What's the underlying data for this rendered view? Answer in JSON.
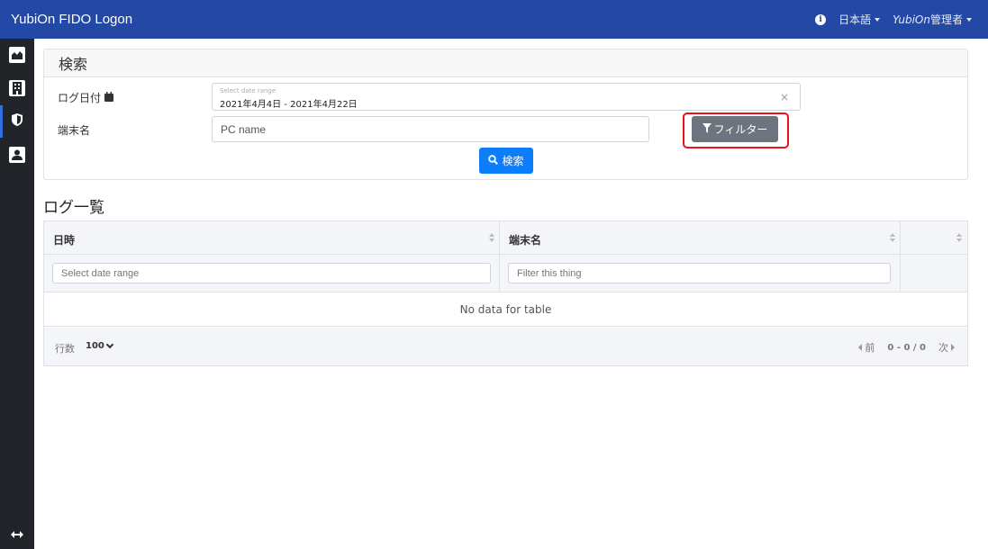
{
  "app": {
    "title": "YubiOn FIDO Logon"
  },
  "nav": {
    "language": "日本語",
    "user_brand": "YubiOn",
    "user_role": "管理者"
  },
  "search": {
    "header": "検索",
    "date_label": "ログ日付",
    "date_placeholder": "Select date range",
    "date_value": "2021年4月4日 - 2021年4月22日",
    "clear_symbol": "×",
    "terminal_label": "端末名",
    "terminal_placeholder": "PC name",
    "filter_button": "フィルター",
    "search_button": "検索"
  },
  "log_list": {
    "title": "ログ一覧",
    "columns": [
      "日時",
      "端末名",
      ""
    ],
    "filters": {
      "date_placeholder": "Select date range",
      "terminal_placeholder": "Filter this thing"
    },
    "empty_message": "No data for table",
    "footer": {
      "rows_label": "行数",
      "rows_value": "100",
      "prev": "前",
      "page_info": "0 - 0 / 0",
      "next": "次"
    }
  },
  "icons": {
    "sidebar": [
      "area-chart-icon",
      "building-icon",
      "shield-icon",
      "user-icon"
    ],
    "sidebar_bottom": "expand-arrows-icon"
  },
  "colors": {
    "navbar": "#2348a6",
    "sidebar": "#212529",
    "primary": "#0d7efa",
    "secondary": "#6c757d",
    "highlight": "#e8141c"
  }
}
